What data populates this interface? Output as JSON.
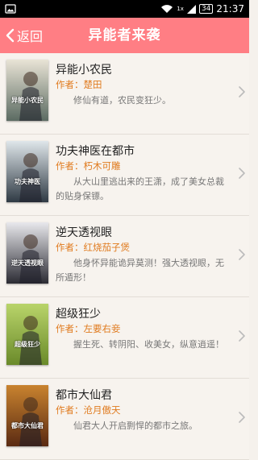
{
  "status_bar": {
    "time": "21:37",
    "battery": "34",
    "signal_label": "1x"
  },
  "header": {
    "back_label": "返回",
    "title": "异能者来袭"
  },
  "books": [
    {
      "title": "异能小农民",
      "author_prefix": "作者：",
      "author": "楚田",
      "description": "修仙有道，农民变狂少。",
      "cover_text": "异能小农民",
      "cover_colors": [
        "#e9e4d6",
        "#5b6b62"
      ]
    },
    {
      "title": "功夫神医在都市",
      "author_prefix": "作者：",
      "author": "朽木可雕",
      "description": "从大山里逃出来的王潇，成了美女总裁的贴身保镖。",
      "cover_text": "功夫神医",
      "cover_colors": [
        "#dfe6ea",
        "#2f3a44"
      ]
    },
    {
      "title": "逆天透视眼",
      "author_prefix": "作者：",
      "author": "红烧茄子煲",
      "description": "他身怀异能诡异莫测！强大透视眼，无所遁形！",
      "cover_text": "逆天透视眼",
      "cover_colors": [
        "#e8e8ec",
        "#2b2b33"
      ]
    },
    {
      "title": "超级狂少",
      "author_prefix": "作者：",
      "author": "左要右妾",
      "description": "握生死、转阴阳、收美女，纵意逍遥！",
      "cover_text": "超级狂少",
      "cover_colors": [
        "#b9d46a",
        "#6a8a2a"
      ]
    },
    {
      "title": "都市大仙君",
      "author_prefix": "作者：",
      "author": "沧月傲天",
      "description": "仙君大人开启剽悍的都市之旅。",
      "cover_text": "都市大仙君",
      "cover_colors": [
        "#c9832f",
        "#5a2a12"
      ]
    }
  ]
}
